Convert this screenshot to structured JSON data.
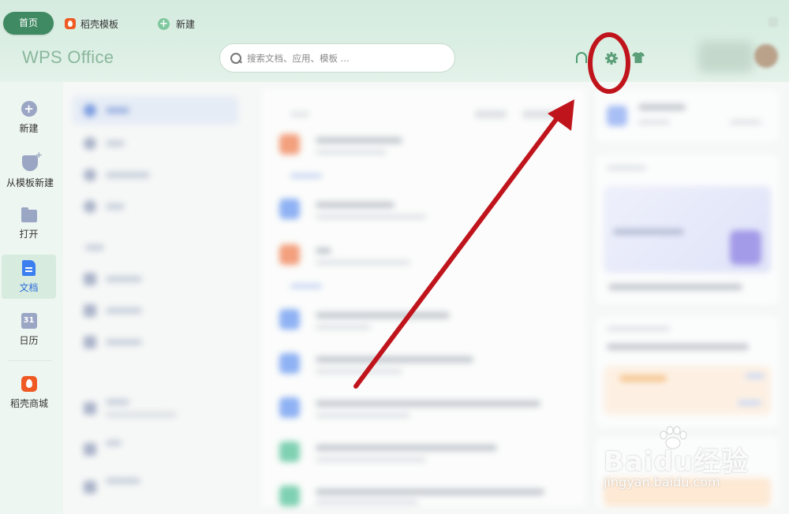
{
  "tabs": {
    "home": "首页",
    "template": "稻壳模板",
    "new": "新建"
  },
  "header": {
    "app_title": "WPS Office",
    "search_placeholder": "搜索文档、应用、模板 ..."
  },
  "icons": {
    "headset": "headset-icon",
    "settings": "gear-icon",
    "skin": "shirt-icon"
  },
  "sidebar": {
    "items": [
      {
        "label": "新建",
        "icon": "plus-circle-icon"
      },
      {
        "label": "从模板新建",
        "icon": "template-icon"
      },
      {
        "label": "打开",
        "icon": "folder-icon"
      },
      {
        "label": "文档",
        "icon": "document-icon",
        "active": true
      },
      {
        "label": "日历",
        "icon": "calendar-icon",
        "icon_text": "31"
      },
      {
        "label": "稻壳商城",
        "icon": "docer-store-icon"
      }
    ]
  },
  "annotation": {
    "highlight_color": "#c0141c"
  },
  "watermark": {
    "brand": "Baidu经验",
    "url": "jingyan.baidu.com"
  },
  "colors": {
    "accent_green": "#3f8a62",
    "active_blue": "#2f6edb",
    "docer_orange": "#ef5a24"
  }
}
